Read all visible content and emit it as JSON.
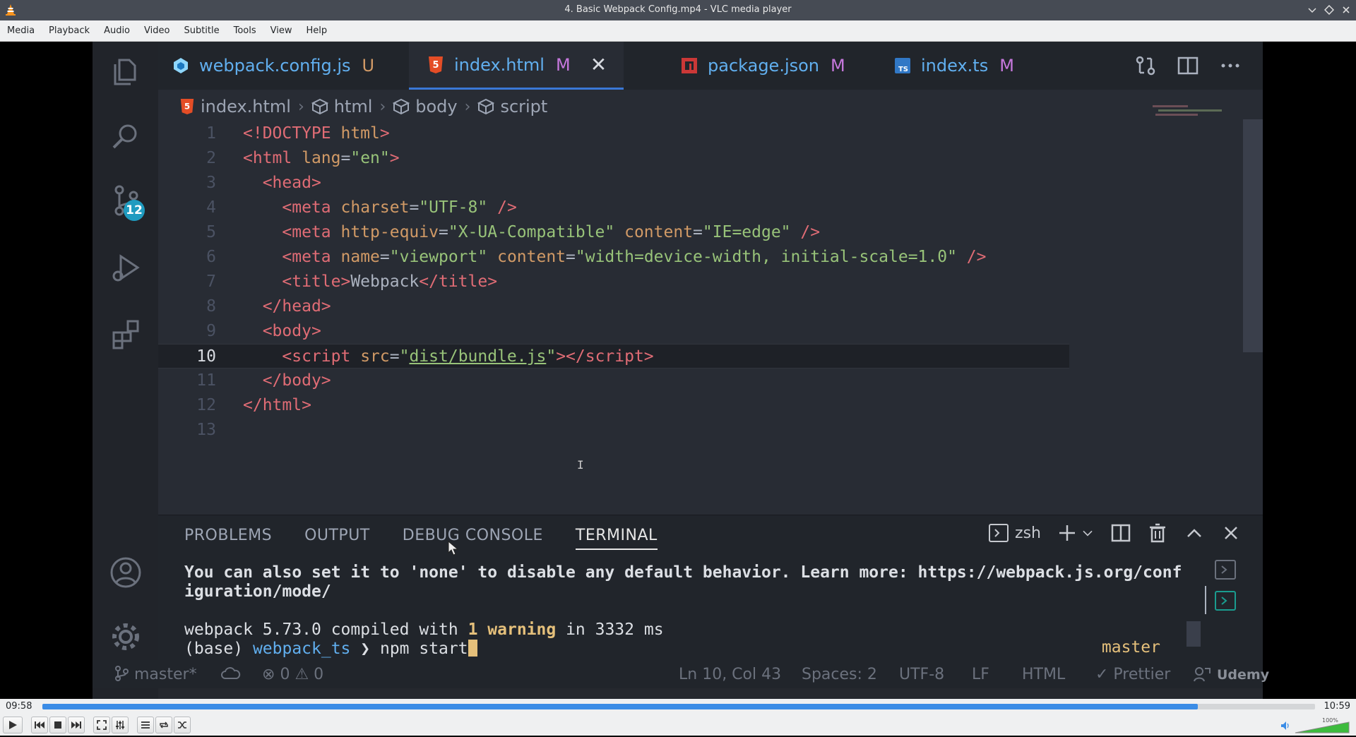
{
  "window": {
    "title": "4. Basic Webpack Config.mp4 - VLC media player"
  },
  "menu": [
    "Media",
    "Playback",
    "Audio",
    "Video",
    "Subtitle",
    "Tools",
    "View",
    "Help"
  ],
  "player": {
    "elapsed": "09:58",
    "total": "10:59",
    "progress_fraction": 0.908,
    "volume_percent": "100%",
    "volume_fraction": 1.0
  },
  "vscode": {
    "scm_badge": "12",
    "tabs": [
      {
        "name": "webpack.config.js",
        "status": "U",
        "icon": "webpack-icon",
        "color": "#61afef",
        "status_color": "#d19a66"
      },
      {
        "name": "index.html",
        "status": "M",
        "icon": "html5-icon",
        "color": "#61afef",
        "status_color": "#c678dd",
        "active": true
      },
      {
        "name": "package.json",
        "status": "M",
        "icon": "npm-icon",
        "color": "#61afef",
        "status_color": "#c678dd"
      },
      {
        "name": "index.ts",
        "status": "M",
        "icon": "typescript-icon",
        "color": "#61afef",
        "status_color": "#c678dd"
      }
    ],
    "breadcrumb": [
      "index.html",
      "html",
      "body",
      "script"
    ],
    "code_lines": [
      {
        "n": "1",
        "html": "<span class=\"t\">&lt;!DOCTYPE</span> <span class=\"a\">html</span><span class=\"t\">&gt;</span>"
      },
      {
        "n": "2",
        "html": "<span class=\"t\">&lt;html</span> <span class=\"a\">lang</span><span class=\"p\">=</span><span class=\"s\">\"en\"</span><span class=\"t\">&gt;</span>"
      },
      {
        "n": "3",
        "html": "  <span class=\"t\">&lt;head&gt;</span>"
      },
      {
        "n": "4",
        "html": "    <span class=\"t\">&lt;meta</span> <span class=\"a\">charset</span><span class=\"p\">=</span><span class=\"s\">\"UTF-8\"</span> <span class=\"t\">/&gt;</span>"
      },
      {
        "n": "5",
        "html": "    <span class=\"t\">&lt;meta</span> <span class=\"a\">http-equiv</span><span class=\"p\">=</span><span class=\"s\">\"X-UA-Compatible\"</span> <span class=\"a\">content</span><span class=\"p\">=</span><span class=\"s\">\"IE=edge\"</span> <span class=\"t\">/&gt;</span>"
      },
      {
        "n": "6",
        "html": "    <span class=\"t\">&lt;meta</span> <span class=\"a\">name</span><span class=\"p\">=</span><span class=\"s\">\"viewport\"</span> <span class=\"a\">content</span><span class=\"p\">=</span><span class=\"s\">\"width=device-width, initial-scale=1.0\"</span> <span class=\"t\">/&gt;</span>"
      },
      {
        "n": "7",
        "html": "    <span class=\"t\">&lt;title&gt;</span><span class=\"p\">Webpack</span><span class=\"t\">&lt;/title&gt;</span>"
      },
      {
        "n": "8",
        "html": "  <span class=\"t\">&lt;/head&gt;</span>"
      },
      {
        "n": "9",
        "html": "  <span class=\"t\">&lt;body&gt;</span>"
      },
      {
        "n": "10",
        "html": "    <span class=\"t\">&lt;script</span> <span class=\"a\">src</span><span class=\"p\">=</span><span class=\"s\">\"<span class=\"u\">dist/bundle.js</span>\"</span><span class=\"t\">&gt;&lt;/script&gt;</span>",
        "current": true
      },
      {
        "n": "11",
        "html": "  <span class=\"t\">&lt;/body&gt;</span>"
      },
      {
        "n": "12",
        "html": "<span class=\"t\">&lt;/html&gt;</span>"
      },
      {
        "n": "13",
        "html": ""
      }
    ],
    "panel": {
      "tabs": [
        "PROBLEMS",
        "OUTPUT",
        "DEBUG CONSOLE",
        "TERMINAL"
      ],
      "active_tab": "TERMINAL",
      "shell": "zsh",
      "terminal": {
        "line1": "You can also set it to 'none' to disable any default behavior. Learn more: https://webpack.js.org/conf",
        "line2": "iguration/mode/",
        "compiled_prefix": "webpack 5.73.0 compiled with ",
        "warning_count": "1",
        "warning_word": " warning",
        "compiled_suffix": " in 3332 ms",
        "prompt_env": "(base) ",
        "prompt_dir": "webpack_ts",
        "prompt_arrow": " ❯ ",
        "command": "npm start",
        "branch": "master"
      }
    },
    "status": {
      "branch": "master*",
      "errors": "0",
      "warnings": "0",
      "position": "Ln 10, Col 43",
      "spaces": "Spaces: 2",
      "encoding": "UTF-8",
      "eol": "LF",
      "language": "HTML",
      "formatter": "✓ Prettier",
      "watermark": "Udemy"
    }
  }
}
